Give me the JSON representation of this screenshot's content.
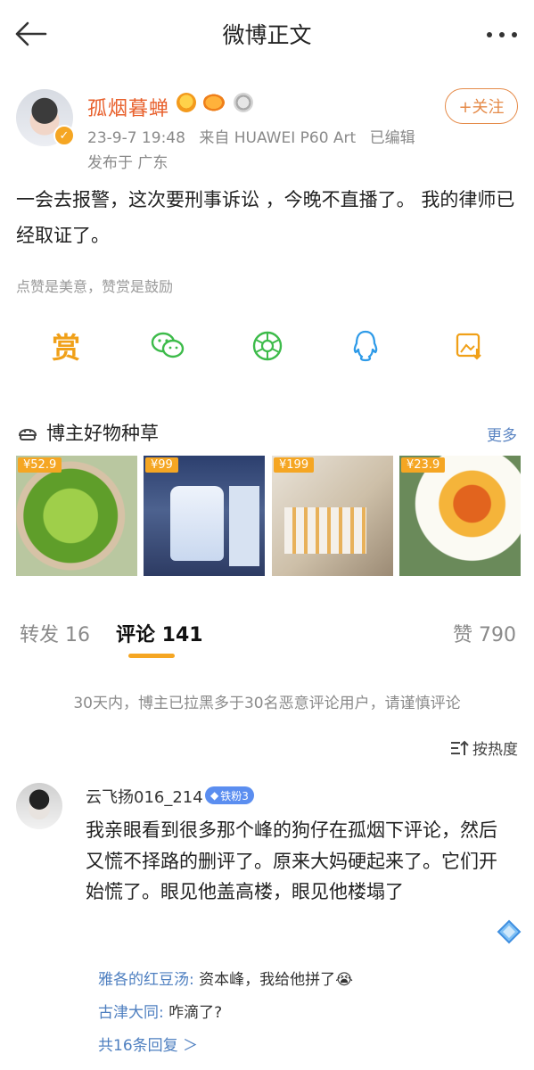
{
  "header": {
    "title": "微博正文"
  },
  "author": {
    "name": "孤烟暮蝉",
    "date": "23-9-7 19:48",
    "source": "来自 HUAWEI P60 Art",
    "edited": "已编辑",
    "location": "发布于 广东",
    "follow_label": "+关注"
  },
  "post": {
    "text": "一会去报警，这次要刑事诉讼 ，今晚不直播了。 我的律师已经取证了。",
    "reward_hint": "点赞是美意，赞赏是鼓励"
  },
  "share": {
    "reward_glyph": "赏"
  },
  "goods": {
    "title": "博主好物种草",
    "more": "更多",
    "items": [
      {
        "price": "¥52.9"
      },
      {
        "price": "¥99"
      },
      {
        "price": "¥199"
      },
      {
        "price": "¥23.9"
      }
    ]
  },
  "tabs": {
    "repost": "转发 16",
    "comment": "评论 141",
    "like": "赞 790"
  },
  "notice": "30天内，博主已拉黑多于30名恶意评论用户，请谨慎评论",
  "sort_label": "按热度",
  "comment": {
    "user": "云飞扬016_214",
    "fan_badge": "铁粉3",
    "text": "我亲眼看到很多那个峰的狗仔在孤烟下评论，然后又慌不择路的删评了。原来大妈硬起来了。它们开始慌了。眼见他盖高楼，眼见他楼塌了",
    "replies": [
      {
        "name": "雅各的红豆汤:",
        "text": " 资本峰，我给他拼了😭"
      },
      {
        "name": "古津大同:",
        "text": " 咋滴了?"
      }
    ],
    "more_replies": "共16条回复 ＞"
  },
  "colors": {
    "accent": "#f5a623",
    "author_name": "#e8602c",
    "link": "#4e7fc0",
    "share_green": "#3dbb4a",
    "share_blue": "#2f9be8"
  }
}
